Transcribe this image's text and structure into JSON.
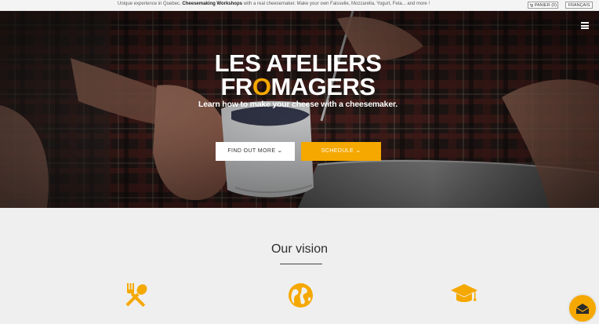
{
  "topbar": {
    "message_prefix": "Unique experience in Quebec. ",
    "message_bold": "Cheesemaking Workshops",
    "message_suffix": " with a real cheesemaker. Make your own Faisselle, Mozzarella, Yogurt, Feta... and more !",
    "cart_label": "PANIER (0)",
    "language_label": "FRANÇAIS"
  },
  "hero": {
    "title_line1": "LES ATELIERS",
    "title_line2_pre": "FR",
    "title_line2_o": "O",
    "title_line2_post": "MAGERS",
    "subtitle": "Learn how to make your cheese with a cheesemaker.",
    "find_out_more_label": "FIND OUT MORE",
    "schedule_label": "SCHEDULE"
  },
  "vision": {
    "heading": "Our vision"
  },
  "icons": {
    "menu": "hamburger-icon",
    "cart": "cart-icon",
    "features": [
      "fork-spoon-icon",
      "globe-icon",
      "graduation-cap-icon"
    ],
    "chat": "envelope-icon"
  },
  "colors": {
    "accent": "#f5a800",
    "page_background": "#efefef",
    "text_dark": "#2e2e2e"
  }
}
